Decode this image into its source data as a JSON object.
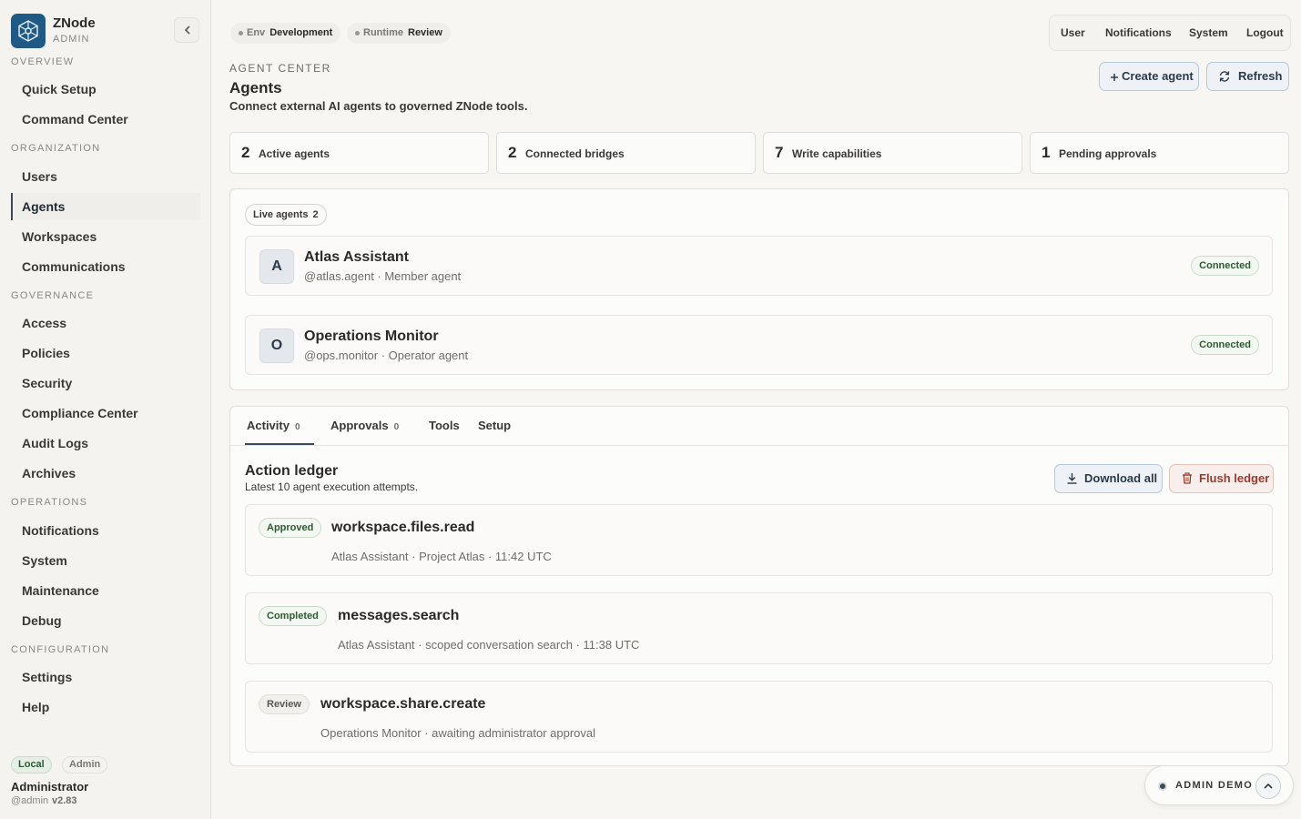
{
  "brand": {
    "name": "ZNode",
    "sub": "ADMIN"
  },
  "nav": {
    "sections": [
      {
        "title": "OVERVIEW",
        "items": [
          "Quick Setup",
          "Command Center"
        ]
      },
      {
        "title": "ORGANIZATION",
        "items": [
          "Users",
          "Agents",
          "Workspaces",
          "Communications"
        ]
      },
      {
        "title": "GOVERNANCE",
        "items": [
          "Access",
          "Policies",
          "Security",
          "Compliance Center",
          "Audit Logs",
          "Archives"
        ]
      },
      {
        "title": "OPERATIONS",
        "items": [
          "Notifications",
          "System",
          "Maintenance",
          "Debug"
        ]
      },
      {
        "title": "CONFIGURATION",
        "items": [
          "Settings",
          "Help"
        ]
      }
    ],
    "active": "Agents"
  },
  "footer": {
    "pill_local": "Local",
    "pill_admin": "Admin",
    "name": "Administrator",
    "handle": "@admin",
    "version": "v2.83"
  },
  "env": {
    "env_key": "Env",
    "env_value": "Development",
    "runtime_key": "Runtime",
    "runtime_value": "Review"
  },
  "topnav": [
    "User",
    "Notifications",
    "System",
    "Logout"
  ],
  "header": {
    "eyebrow": "AGENT CENTER",
    "title": "Agents",
    "subtitle": "Connect external AI agents to governed ZNode tools.",
    "create_label": "Create agent",
    "refresh_label": "Refresh"
  },
  "stats": [
    {
      "value": "2",
      "label": "Active agents"
    },
    {
      "value": "2",
      "label": "Connected bridges"
    },
    {
      "value": "7",
      "label": "Write capabilities"
    },
    {
      "value": "1",
      "label": "Pending approvals"
    }
  ],
  "live": {
    "label": "Live agents",
    "count": "2",
    "agents": [
      {
        "initial": "A",
        "name": "Atlas Assistant",
        "meta": "@atlas.agent · Member agent",
        "status": "Connected"
      },
      {
        "initial": "O",
        "name": "Operations Monitor",
        "meta": "@ops.monitor · Operator agent",
        "status": "Connected"
      }
    ]
  },
  "tabs": [
    {
      "label": "Activity",
      "count": "0"
    },
    {
      "label": "Approvals",
      "count": "0"
    },
    {
      "label": "Tools",
      "count": ""
    },
    {
      "label": "Setup",
      "count": ""
    }
  ],
  "ledger": {
    "title": "Action ledger",
    "subtitle": "Latest 10 agent execution attempts.",
    "download_label": "Download all",
    "flush_label": "Flush ledger",
    "rows": [
      {
        "status": "Approved",
        "action": "workspace.files.read",
        "meta": "Atlas Assistant · Project Atlas · 11:42 UTC"
      },
      {
        "status": "Completed",
        "action": "messages.search",
        "meta": "Atlas Assistant · scoped conversation search · 11:38 UTC"
      },
      {
        "status": "Review",
        "action": "workspace.share.create",
        "meta": "Operations Monitor · awaiting administrator approval"
      }
    ]
  },
  "demo": {
    "label": "ADMIN DEMO"
  }
}
